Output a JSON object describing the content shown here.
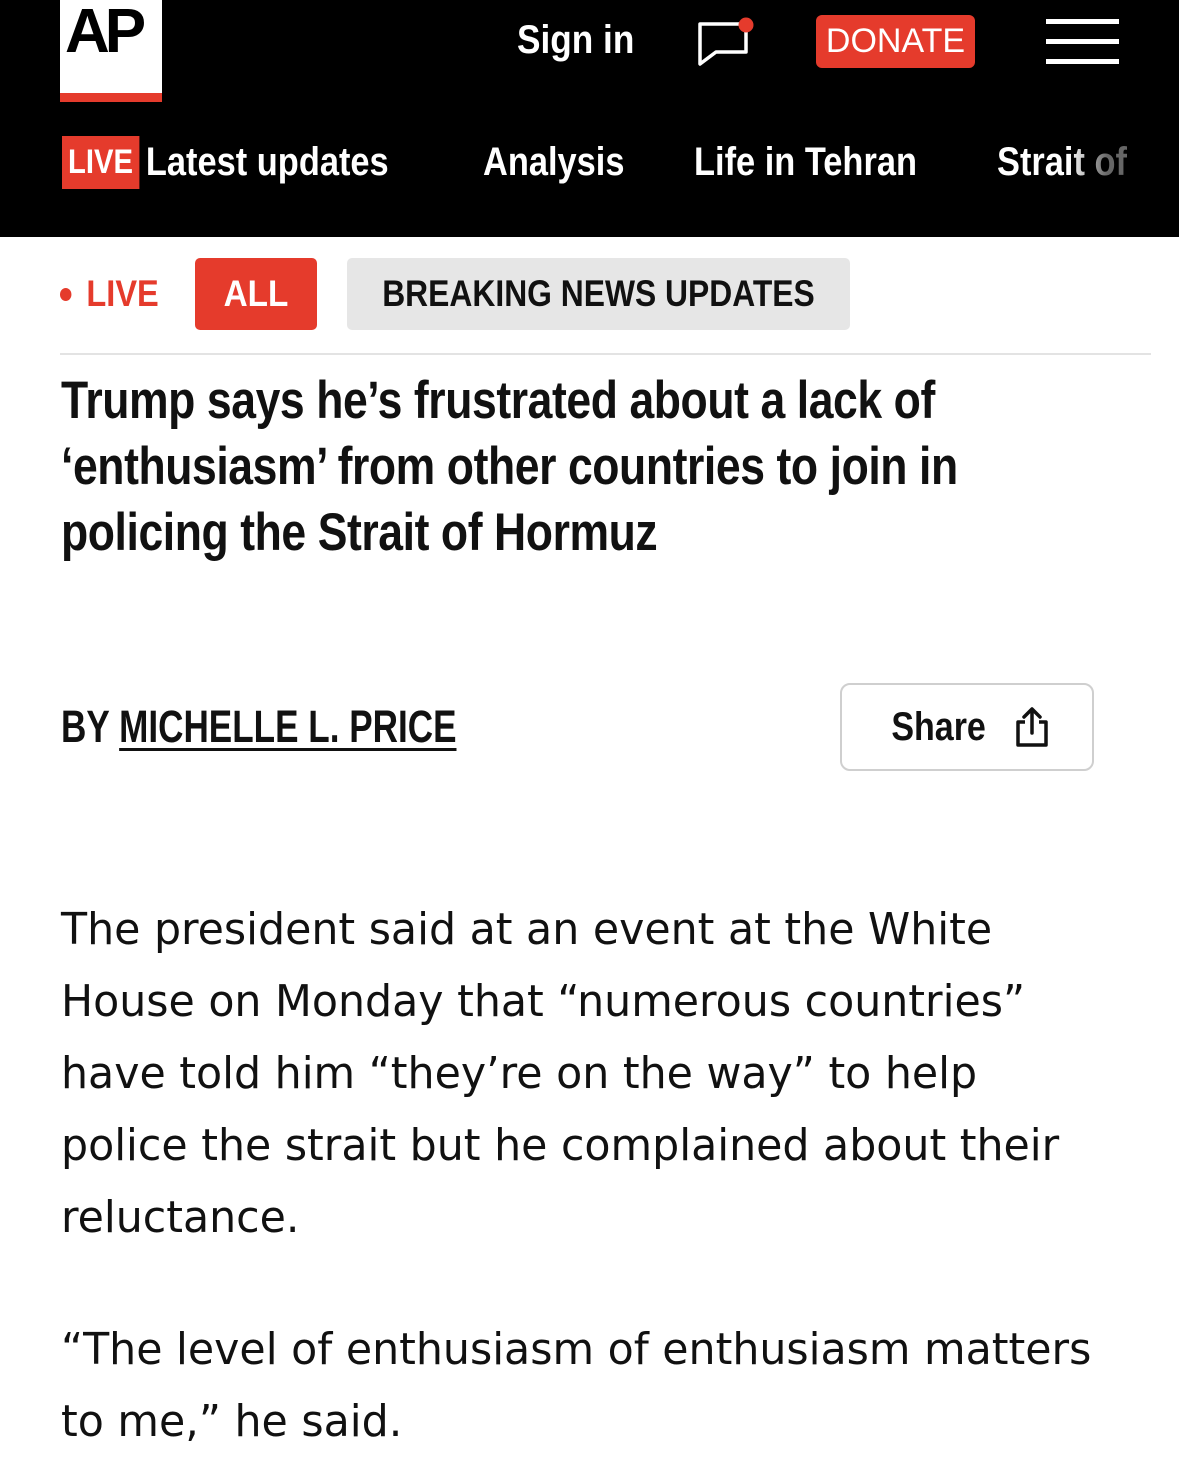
{
  "header": {
    "logo_text": "AP",
    "sign_in_label": "Sign in",
    "chat_icon": "chat-bubble-icon",
    "donate_label": "DONATE",
    "menu_icon": "hamburger-menu-icon",
    "colors": {
      "accent": "#e53b2c",
      "background": "#000000"
    }
  },
  "nav": {
    "live_tag": "LIVE",
    "items": [
      {
        "label": "Latest updates"
      },
      {
        "label": "Analysis"
      },
      {
        "label": "Life in Tehran"
      },
      {
        "label": "Strait of"
      }
    ]
  },
  "tabs": {
    "live_label": "LIVE",
    "all_label": "ALL",
    "breaking_label": "BREAKING NEWS UPDATES",
    "selected": "ALL"
  },
  "article": {
    "headline": "Trump says he’s frustrated about a lack of ‘enthusiasm’ from other countries to join in policing the Strait of Hormuz",
    "byline_prefix": "BY",
    "author": "MICHELLE L. PRICE",
    "share_label": "Share",
    "paragraphs": [
      "The president said at an event at the White House on Monday that “numerous countries” have told him “they’re on the way” to help police the strait but he complained about their reluctance.",
      "“The level of enthusiasm of enthusiasm matters to me,” he said."
    ]
  }
}
